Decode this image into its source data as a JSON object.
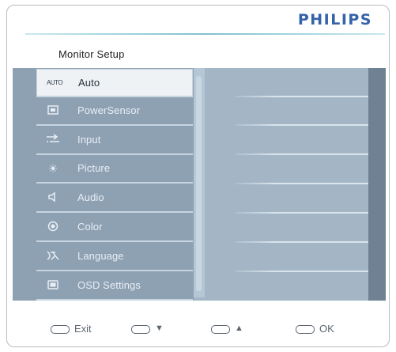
{
  "brand": "PHILIPS",
  "menu_title": "Monitor Setup",
  "menu_items": [
    {
      "label": "Auto",
      "icon": "auto-icon"
    },
    {
      "label": "PowerSensor",
      "icon": "powersensor-icon"
    },
    {
      "label": "Input",
      "icon": "input-icon"
    },
    {
      "label": "Picture",
      "icon": "picture-icon"
    },
    {
      "label": "Audio",
      "icon": "speaker-icon"
    },
    {
      "label": "Color",
      "icon": "color-icon"
    },
    {
      "label": "Language",
      "icon": "language-icon"
    },
    {
      "label": "OSD Settings",
      "icon": "osd-settings-icon"
    }
  ],
  "selected_item": "Auto",
  "footer": {
    "exit_label": "Exit",
    "down_label": "▼",
    "up_label": "▲",
    "ok_label": "OK"
  },
  "colors": {
    "brand": "#3563a8",
    "panel": "#8ea1b3",
    "selected_bg": "#eef2f5"
  }
}
